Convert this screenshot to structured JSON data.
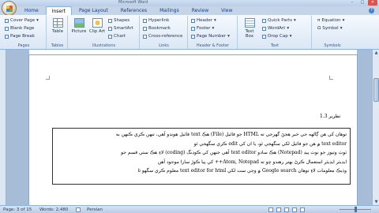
{
  "window": {
    "title": "Microsoft Word"
  },
  "tabs": [
    "Home",
    "Insert",
    "Page Layout",
    "References",
    "Mailings",
    "Review",
    "View"
  ],
  "ribbon": {
    "pages": {
      "label": "Pages",
      "items": [
        "Cover Page",
        "Blank Page",
        "Page Break"
      ]
    },
    "tables": {
      "label": "Tables",
      "button": "Table"
    },
    "illustrations": {
      "label": "Illustrations",
      "big": [
        "Picture",
        "Clip Art"
      ],
      "items": [
        "Shapes",
        "SmartArt",
        "Chart"
      ]
    },
    "links": {
      "label": "Links",
      "items": [
        "Hyperlink",
        "Bookmark",
        "Cross-reference"
      ]
    },
    "header_footer": {
      "label": "Header & Footer",
      "items": [
        "Header",
        "Footer",
        "Page Number"
      ]
    },
    "text": {
      "label": "Text",
      "big": "Text Box",
      "items": [
        "Quick Parts",
        "WordArt",
        "Drop Cap"
      ]
    },
    "symbols": {
      "label": "Symbols",
      "items": [
        "Equation",
        "Symbol"
      ]
    }
  },
  "document": {
    "heading": "1.3 تظرير",
    "lines": [
      "توهان کي هن ڳالهه جي خبر هجڻ گهرجي ته HTML جو فائيل (File) هڪ text فائيل هوندو آهي، تنهن ڪري ڪنهن به",
      "text editor ۾ هن جو فائيل لکي سگهجي ٿو، يا ان کي edit ڪري سگهجي ٿو",
      "ٽوٽ وٺيوز جو نوٽ پيڊ (Notepad) هڪ سادو text editor آهي جنهن کي ڪوڊنگ (coding) لاءِ هڪ سٺي قسم جو",
      "ايڊيٽر ايڊيٽر استعمال ڪرڻ بهتر رهندو ڇو ته Atom, Notepad++ کي پيا ڪوڙ سارا موجود آهن",
      "وڌيڪ معلومات لاءِ توهان Google search ۾ وڃي سٺ لکي text editor for html معلوم ڪري سگهو ٿا"
    ]
  },
  "status": {
    "page": "Page: 3 of 15",
    "words": "Words: 2,480",
    "language": "Persian"
  }
}
